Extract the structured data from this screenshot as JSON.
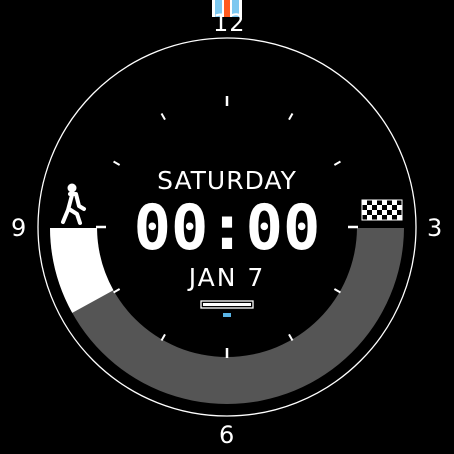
{
  "watch_face": {
    "day_of_week": "SATURDAY",
    "time": "00:00",
    "date": "JAN 7",
    "hour_markers": {
      "twelve": "12",
      "three": "3",
      "six": "6",
      "nine": "9"
    },
    "step_goal_progress": 0.16,
    "battery_level": 0.5,
    "icons": {
      "steps": "walking-person-icon",
      "goal": "checkered-flag-icon",
      "top_badge": "stripe-badge-icon"
    },
    "colors": {
      "background": "#000000",
      "foreground": "#ffffff",
      "progress_fill": "#ffffff",
      "progress_track": "#555555",
      "battery_indicator": "#5ab4e6",
      "badge_orange": "#ff5a1e",
      "badge_blue": "#7dc8f0"
    }
  }
}
